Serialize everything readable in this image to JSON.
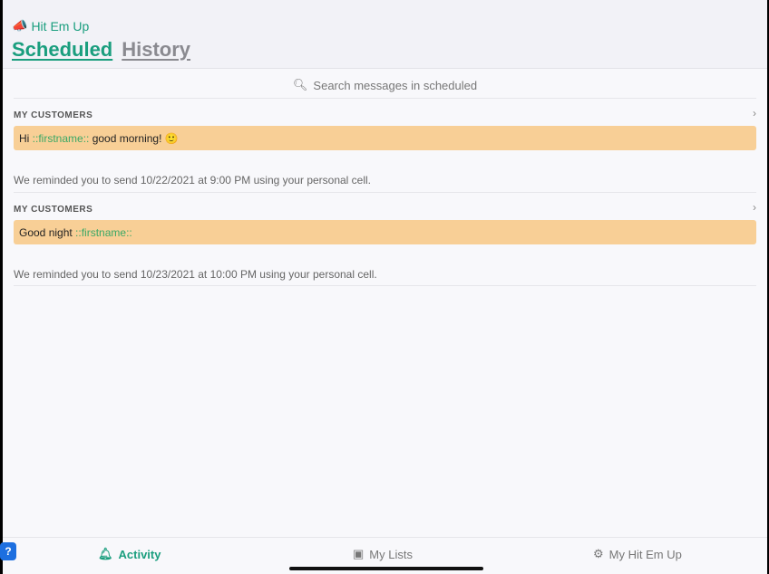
{
  "app": {
    "name": "Hit Em Up",
    "accent": "#1a9e7e"
  },
  "tabs": [
    {
      "label": "Scheduled",
      "active": true
    },
    {
      "label": "History",
      "active": false
    }
  ],
  "search": {
    "placeholder": "Search messages in scheduled"
  },
  "messages": [
    {
      "group": "MY CUSTOMERS",
      "parts": [
        "Hi ",
        "::firstname::",
        " good morning! 🙂"
      ],
      "note": "We reminded you to send  10/22/2021 at 9:00 PM using your personal cell."
    },
    {
      "group": "MY CUSTOMERS",
      "parts": [
        "Good night ",
        "::firstname::",
        ""
      ],
      "note": "We reminded you to send  10/23/2021 at 10:00 PM using your personal cell."
    }
  ],
  "bottom_nav": [
    {
      "label": "Activity",
      "icon": "bell-icon",
      "active": true
    },
    {
      "label": "My Lists",
      "icon": "chat-icon"
    },
    {
      "label": "My Hit Em Up",
      "icon": "gear-icon"
    }
  ],
  "help": "?"
}
